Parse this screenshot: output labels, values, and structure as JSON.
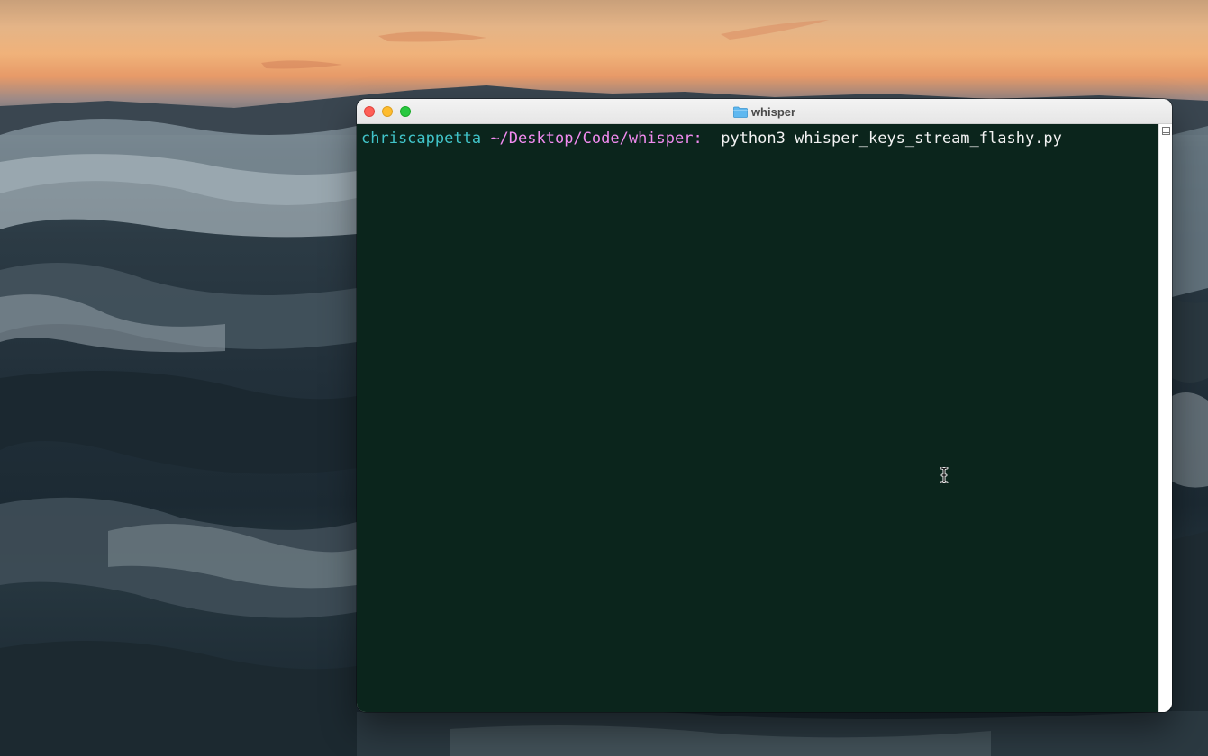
{
  "window": {
    "title": "whisper",
    "title_icon": "folder-icon",
    "buttons": [
      "close",
      "minimize",
      "zoom"
    ]
  },
  "terminal": {
    "lines": [
      {
        "user": "chriscappetta",
        "path": "~/Desktop/Code/whisper:",
        "command": "python3 whisper_keys_stream_flashy.py"
      }
    ]
  },
  "colors": {
    "terminal_bg": "#0b251c",
    "prompt_user": "#41c4c9",
    "prompt_path": "#f28bf0",
    "command_text": "#f2f2f2",
    "close": "#fe5f57",
    "minimize": "#febc2e",
    "zoom": "#28c840",
    "folder": "#5fb8f0"
  },
  "cursor": "ibeam-cursor-icon"
}
